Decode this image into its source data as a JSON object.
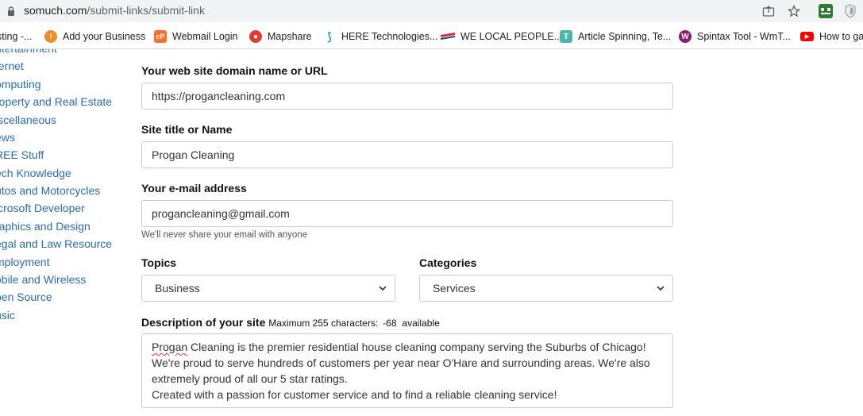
{
  "browser": {
    "url_host": "somuch.com",
    "url_path": "/submit-links/submit-link",
    "bookmarks": [
      {
        "label": "sting -...",
        "icon": "none",
        "color": "#ffffff"
      },
      {
        "label": "Add your Business",
        "icon": "lightbulb-icon",
        "color": "#f28c28"
      },
      {
        "label": "Webmail Login",
        "icon": "cpanel-icon",
        "color": "#ff6c2c"
      },
      {
        "label": "Mapshare",
        "icon": "mapshare-icon",
        "color": "#e53935"
      },
      {
        "label": "HERE Technologies...",
        "icon": "here-icon",
        "color": "#26a69a"
      },
      {
        "label": "WE LOCAL PEOPLE...",
        "icon": "flag-icon",
        "color": "#d32f2f"
      },
      {
        "label": "Article Spinning, Te...",
        "icon": "t-icon",
        "color": "#4db6ac"
      },
      {
        "label": "Spintax Tool - WmT...",
        "icon": "w-icon",
        "color": "#8e1b6b"
      },
      {
        "label": "How to ga",
        "icon": "youtube-icon",
        "color": "#ff0000"
      }
    ]
  },
  "sidebar": {
    "items": [
      "ntertainment",
      "ternet",
      "omputing",
      "roperty and Real Estate",
      "iscellaneous",
      "ews",
      "REE Stuff",
      "ech Knowledge",
      "utos and Motorcycles",
      "icrosoft Developer",
      "raphics and Design",
      "egal and Law Resource",
      "mployment",
      "obile and Wireless",
      "pen Source",
      "usic"
    ]
  },
  "form": {
    "url_label": "Your web site domain name or URL",
    "url_value": "https://progancleaning.com",
    "title_label": "Site title or Name",
    "title_value": "Progan Cleaning",
    "email_label": "Your e-mail address",
    "email_value": "progancleaning@gmail.com",
    "email_hint": "We'll never share your email with anyone",
    "topics_label": "Topics",
    "topics_value": "Business",
    "categories_label": "Categories",
    "categories_value": "Services",
    "description_label": "Description of your site",
    "description_limit_prefix": "Maximum 255 characters:",
    "description_remaining": "-68",
    "description_limit_suffix": "available",
    "description_word_first": "Progan",
    "description_lines": [
      " Cleaning is the premier residential house cleaning company serving the Suburbs of Chicago!",
      "We're proud to serve hundreds of customers per year near O'Hare and surrounding areas. We're also",
      "extremely proud of all our 5 star ratings.",
      "Created with a passion for customer service and to find a reliable cleaning service!"
    ]
  }
}
